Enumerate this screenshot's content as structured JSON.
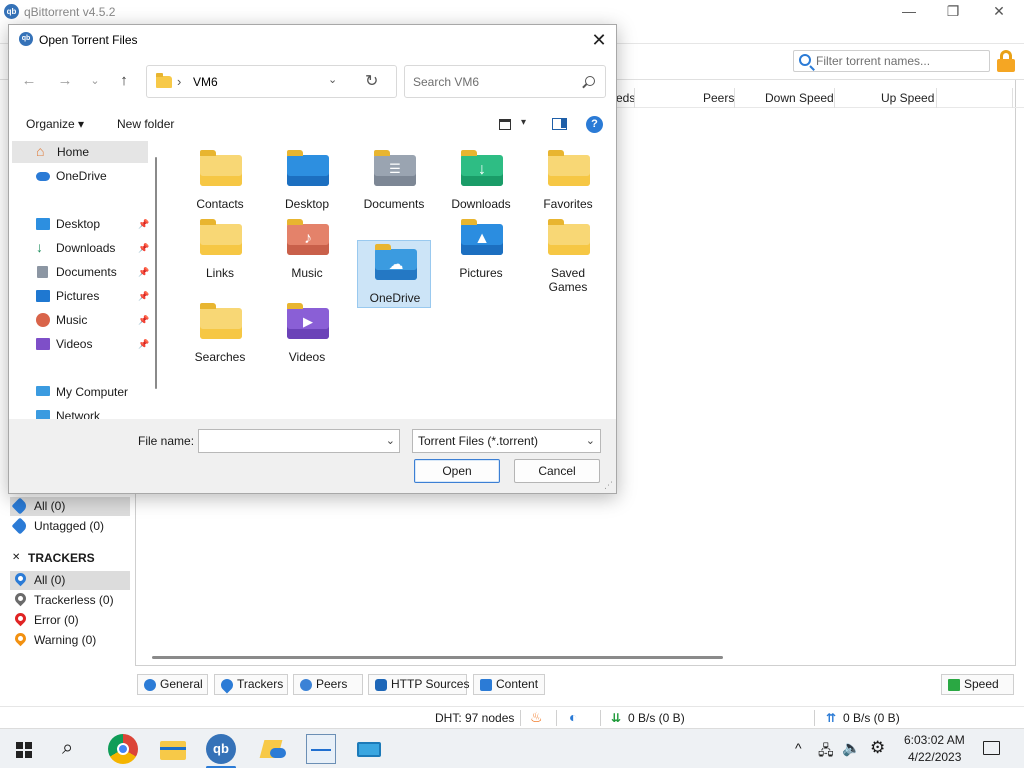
{
  "app": {
    "title": "qBittorrent v4.5.2",
    "logo_text": "qb",
    "window_controls": {
      "minimize": "—",
      "maximize": "❐",
      "close": "✕"
    }
  },
  "toolbar": {
    "filter_placeholder": "Filter torrent names..."
  },
  "columns": [
    "eds",
    "Peers",
    "Down Speed",
    "Up Speed"
  ],
  "sidebar": {
    "tags": [
      {
        "label": "All (0)",
        "selected": true
      },
      {
        "label": "Untagged (0)",
        "selected": false
      }
    ],
    "trackers_heading": "TRACKERS",
    "trackers": [
      {
        "label": "All (0)",
        "color": "#2b7bd6",
        "selected": true
      },
      {
        "label": "Trackerless (0)",
        "color": "#6b6b6b",
        "selected": false
      },
      {
        "label": "Error (0)",
        "color": "#e02424",
        "selected": false
      },
      {
        "label": "Warning (0)",
        "color": "#f29111",
        "selected": false
      }
    ]
  },
  "bottom_tabs": [
    "General",
    "Trackers",
    "Peers",
    "HTTP Sources",
    "Content"
  ],
  "speed_button": "Speed",
  "status": {
    "dht": "DHT: 97 nodes",
    "down": "0 B/s (0 B)",
    "up": "0 B/s (0 B)"
  },
  "dialog": {
    "title": "Open Torrent Files",
    "close": "✕",
    "address": "VM6",
    "search_placeholder": "Search VM6",
    "organize": "Organize ▾",
    "new_folder": "New folder",
    "help": "?",
    "nav_items": [
      {
        "label": "Home",
        "selected": true,
        "pinned": false
      },
      {
        "label": "OneDrive",
        "selected": false,
        "pinned": false
      },
      {
        "label": "Desktop",
        "selected": false,
        "pinned": true
      },
      {
        "label": "Downloads",
        "selected": false,
        "pinned": true
      },
      {
        "label": "Documents",
        "selected": false,
        "pinned": true
      },
      {
        "label": "Pictures",
        "selected": false,
        "pinned": true
      },
      {
        "label": "Music",
        "selected": false,
        "pinned": true
      },
      {
        "label": "Videos",
        "selected": false,
        "pinned": true
      },
      {
        "label": "My Computer",
        "selected": false,
        "pinned": false
      },
      {
        "label": "Network",
        "selected": false,
        "pinned": false
      }
    ],
    "files": [
      {
        "label": "Contacts",
        "selected": false
      },
      {
        "label": "Desktop",
        "selected": false
      },
      {
        "label": "Documents",
        "selected": false
      },
      {
        "label": "Downloads",
        "selected": false
      },
      {
        "label": "Favorites",
        "selected": false
      },
      {
        "label": "Links",
        "selected": false
      },
      {
        "label": "Music",
        "selected": false
      },
      {
        "label": "OneDrive",
        "selected": true
      },
      {
        "label": "Pictures",
        "selected": false
      },
      {
        "label": "Saved Games",
        "selected": false
      },
      {
        "label": "Searches",
        "selected": false
      },
      {
        "label": "Videos",
        "selected": false
      }
    ],
    "file_name_label": "File name:",
    "file_name_value": "",
    "file_type": "Torrent Files (*.torrent)",
    "open_button": "Open",
    "cancel_button": "Cancel"
  },
  "taskbar": {
    "time": "6:03:02 AM",
    "date": "4/22/2023"
  }
}
